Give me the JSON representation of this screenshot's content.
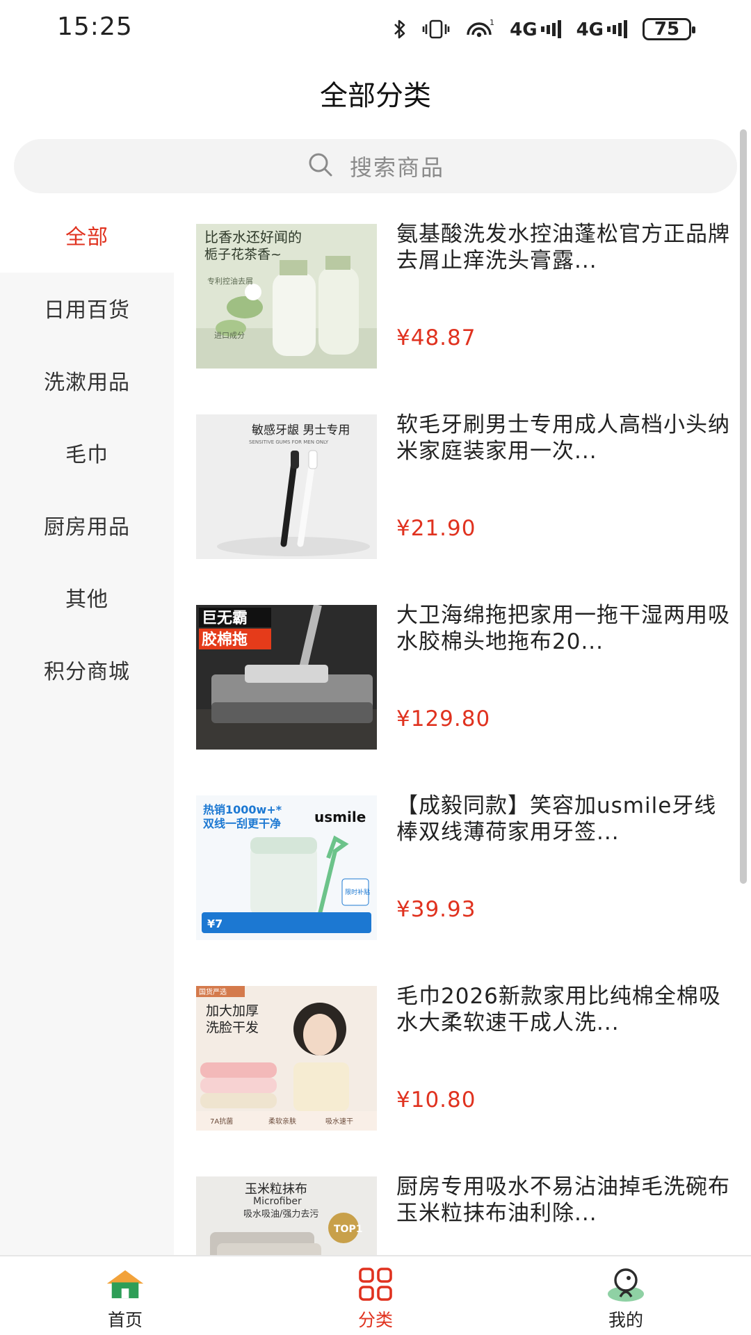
{
  "status_bar": {
    "time": "15:25",
    "battery": "75",
    "network_1": "4G",
    "network_2": "4G",
    "icons": [
      "bluetooth-icon",
      "vibrate-icon",
      "hotspot-icon",
      "signal-icon",
      "signal-icon",
      "battery-icon"
    ]
  },
  "header": {
    "title": "全部分类"
  },
  "search": {
    "placeholder": "搜索商品",
    "icon": "search-icon"
  },
  "sidebar": {
    "items": [
      {
        "label": "全部",
        "active": true
      },
      {
        "label": "日用百货"
      },
      {
        "label": "洗漱用品"
      },
      {
        "label": "毛巾"
      },
      {
        "label": "厨房用品"
      },
      {
        "label": "其他"
      },
      {
        "label": "积分商城"
      }
    ]
  },
  "products": [
    {
      "title": "氨基酸洗发水控油蓬松官方正品牌去屑止痒洗头膏露...",
      "price": "¥48.87",
      "image_text": [
        "比香水还好闻的",
        "栀子花茶香~",
        "专利控油去屑",
        "进口成分"
      ]
    },
    {
      "title": "软毛牙刷男士专用成人高档小头纳米家庭装家用一次...",
      "price": "¥21.90",
      "image_text": [
        "敏感牙龈 男士专用",
        "SENSITIVE GUMS FOR MEN ONLY"
      ]
    },
    {
      "title": "大卫海绵拖把家用一拖干湿两用吸水胶棉头地拖布20...",
      "price": "¥129.80",
      "image_text": [
        "巨无霸",
        "胶棉拖"
      ]
    },
    {
      "title": "【成毅同款】笑容加usmile牙线棒双线薄荷家用牙签...",
      "price": "¥39.93",
      "image_text": [
        "热销1000w+*",
        "双线一刮更干净",
        "usmile",
        "限时补贴",
        "¥7"
      ]
    },
    {
      "title": "毛巾2026新款家用比纯棉全棉吸水大柔软速干成人洗...",
      "price": "¥10.80",
      "image_text": [
        "国货严选",
        "加大加厚",
        "洗脸干发",
        "7A抗菌",
        "柔软亲肤",
        "吸水速干"
      ]
    },
    {
      "title": "厨房专用吸水不易沾油掉毛洗碗布玉米粒抹布油利除...",
      "price": "",
      "image_text": [
        "玉米粒抹布",
        "Microfiber",
        "吸水吸油/强力去污",
        "TOP1"
      ]
    }
  ],
  "tabbar": {
    "items": [
      {
        "label": "首页",
        "icon": "home-icon"
      },
      {
        "label": "分类",
        "icon": "category-grid-icon",
        "active": true
      },
      {
        "label": "我的",
        "icon": "profile-icon"
      }
    ]
  },
  "colors": {
    "accent": "#e0321f",
    "home_green": "#2e9e57",
    "home_orange": "#f2a23a"
  }
}
